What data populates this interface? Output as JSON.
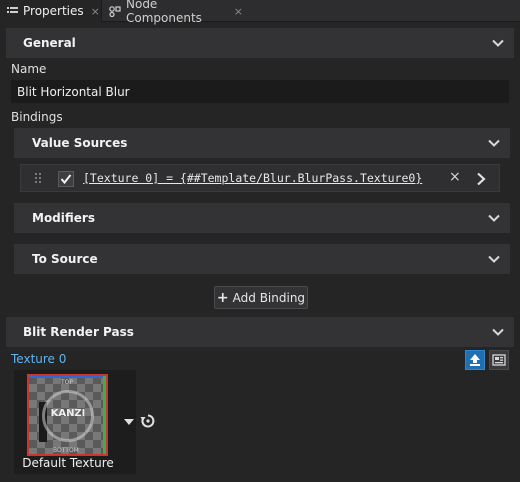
{
  "tabs": [
    {
      "label": "Properties",
      "icon": "list-icon",
      "close": "×"
    },
    {
      "label": "Node Components",
      "icon": "nodes-icon",
      "close": "×"
    }
  ],
  "general": {
    "title": "General",
    "name_label": "Name",
    "name_value": "Blit Horizontal Blur",
    "bindings_label": "Bindings"
  },
  "value_sources": {
    "title": "Value Sources",
    "binding": {
      "checked": true,
      "expression": "[Texture 0] = {##Template/Blur.BlurPass.Texture0}",
      "remove": "×"
    }
  },
  "modifiers": {
    "title": "Modifiers"
  },
  "to_source": {
    "title": "To Source"
  },
  "add_binding": {
    "label": "Add Binding"
  },
  "blit_render_pass": {
    "title": "Blit Render Pass",
    "texture_label": "Texture 0",
    "texture_caption": "Default Texture",
    "thumbnail_text": "KANZI",
    "thumbnail_top": "TOP",
    "thumbnail_bottom": "BOTTOM"
  },
  "colors": {
    "background": "#252526",
    "header": "#333335",
    "link": "#5fb4ee",
    "accent": "#1f6fb3"
  }
}
